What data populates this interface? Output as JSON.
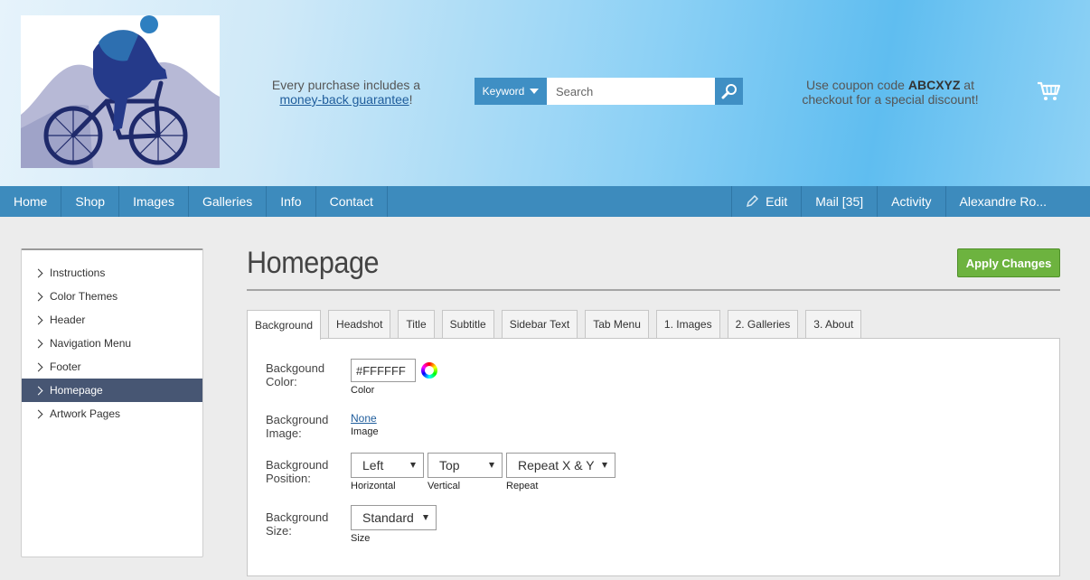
{
  "header": {
    "promo_line1": "Every purchase includes a",
    "promo_link": "money-back guarantee",
    "promo_end": "!",
    "search_scope": "Keyword",
    "search_placeholder": "Search",
    "coupon_pre": "Use coupon code ",
    "coupon_code": "ABCXYZ",
    "coupon_post": " at checkout for a special discount!"
  },
  "nav": {
    "left": [
      "Home",
      "Shop",
      "Images",
      "Galleries",
      "Info",
      "Contact"
    ],
    "edit": "Edit",
    "mail": "Mail [35]",
    "activity": "Activity",
    "user": "Alexandre Ro..."
  },
  "sidebar": {
    "items": [
      {
        "label": "Instructions"
      },
      {
        "label": "Color Themes"
      },
      {
        "label": "Header"
      },
      {
        "label": "Navigation Menu"
      },
      {
        "label": "Footer"
      },
      {
        "label": "Homepage",
        "active": true
      },
      {
        "label": "Artwork Pages"
      }
    ]
  },
  "main": {
    "title": "Homepage",
    "apply_label": "Apply Changes",
    "tabs": [
      "Background",
      "Headshot",
      "Title",
      "Subtitle",
      "Sidebar Text",
      "Tab Menu",
      "1. Images",
      "2. Galleries",
      "3. About"
    ],
    "active_tab": "Background",
    "form": {
      "bg_color": {
        "label1": "Backgound",
        "label2": "Color:",
        "value": "#FFFFFF",
        "sub": "Color"
      },
      "bg_image": {
        "label1": "Background",
        "label2": "Image:",
        "value": "None",
        "sub": "Image"
      },
      "bg_position": {
        "label1": "Background",
        "label2": "Position:",
        "horizontal": "Left",
        "horizontal_sub": "Horizontal",
        "vertical": "Top",
        "vertical_sub": "Vertical",
        "repeat": "Repeat X & Y",
        "repeat_sub": "Repeat"
      },
      "bg_size": {
        "label1": "Background",
        "label2": "Size:",
        "value": "Standard",
        "sub": "Size"
      }
    }
  },
  "colors": {
    "nav_bg": "#3d8bbd",
    "apply_green": "#6db33f",
    "sidebar_active": "#475673",
    "link": "#1f5d9c"
  },
  "icons": [
    "cyclist-logo",
    "chevron-down-icon",
    "search-icon",
    "cart-icon",
    "pencil-icon",
    "chevron-right-icon",
    "color-wheel-icon"
  ]
}
